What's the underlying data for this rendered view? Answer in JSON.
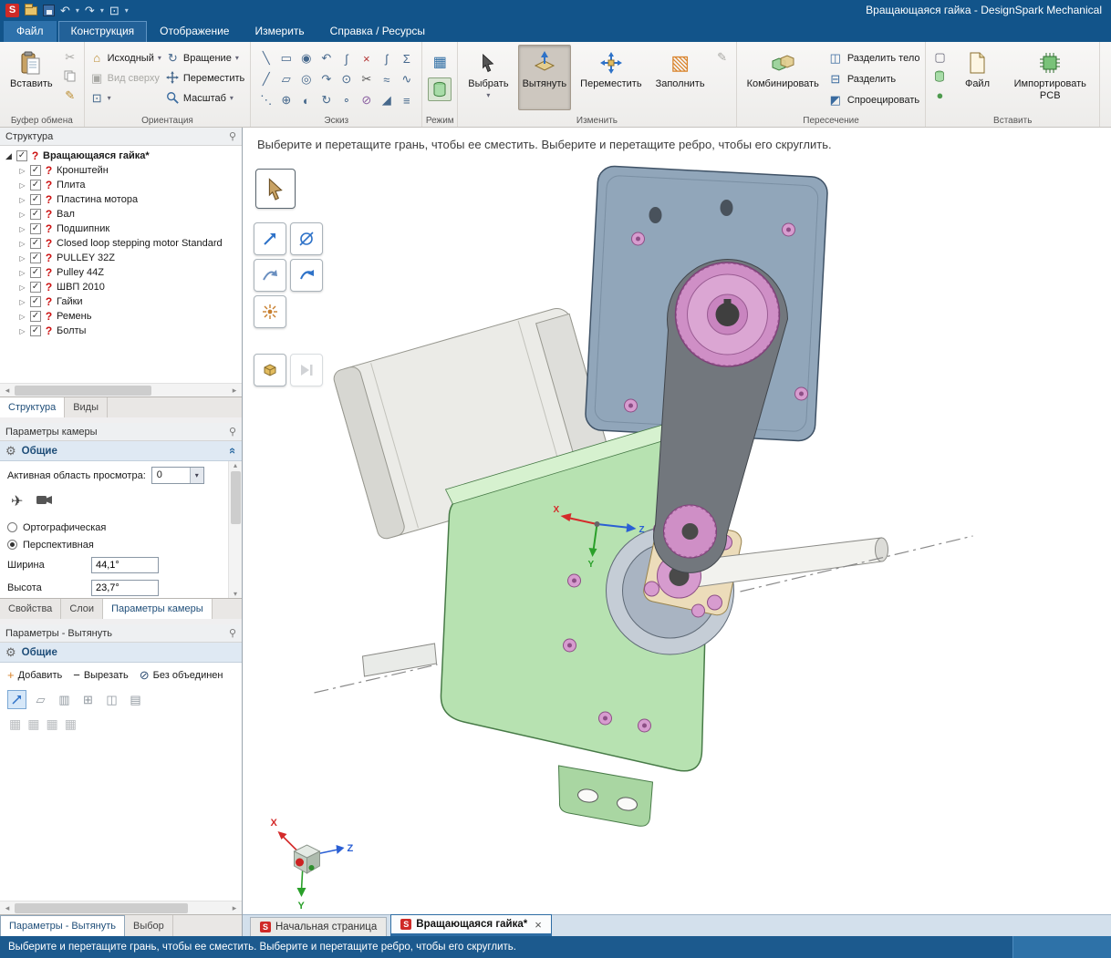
{
  "titlebar": {
    "title": "Вращающаяся гайка - DesignSpark Mechanical"
  },
  "menu": {
    "file": "Файл",
    "construct": "Конструкция",
    "display": "Отображение",
    "measure": "Измерить",
    "help": "Справка / Ресурсы"
  },
  "ribbon": {
    "clipboard": {
      "label": "Буфер обмена",
      "paste": "Вставить"
    },
    "orientation": {
      "label": "Ориентация",
      "home": "Исходный",
      "spin": "Вращение",
      "top": "Вид сверху",
      "pan": "Переместить",
      "zoom": "Масштаб"
    },
    "sketch": {
      "label": "Эскиз",
      "icons": [
        "╲",
        "▭",
        "◉",
        "↶",
        "∫",
        "×",
        "ʃ",
        "Σ",
        "╱",
        "▱",
        "◎",
        "↷",
        "⊙",
        "✂",
        "≈",
        "∿",
        "⋱",
        "⊕",
        "◐",
        "↻",
        "∘",
        "⊘",
        "◢",
        "≡"
      ]
    },
    "mode": {
      "label": "Режим"
    },
    "edit": {
      "label": "Изменить",
      "select": "Выбрать",
      "pull": "Вытянуть",
      "move": "Переместить",
      "fill": "Заполнить"
    },
    "intersect": {
      "label": "Пересечение",
      "combine": "Комбинировать",
      "split_body": "Разделить тело",
      "split": "Разделить",
      "project": "Спроецировать"
    },
    "insert": {
      "label": "Вставить",
      "file": "Файл",
      "pcb": "Импортировать PCB"
    }
  },
  "structure": {
    "header": "Структура",
    "root": "Вращающаяся гайка*",
    "items": [
      "Кронштейн",
      "Плита",
      "Пластина мотора",
      "Вал",
      "Подшипник",
      "Closed loop stepping motor Standard",
      "PULLEY 32Z",
      "Pulley 44Z",
      "ШВП 2010",
      "Гайки",
      "Ремень",
      "Болты"
    ],
    "tab_structure": "Структура",
    "tab_views": "Виды"
  },
  "camera": {
    "header": "Параметры камеры",
    "section": "Общие",
    "active_area_label": "Активная область просмотра:",
    "active_area_value": "0",
    "ortho": "Ортографическая",
    "persp": "Перспективная",
    "width_label": "Ширина",
    "width_value": "44,1°",
    "height_label": "Высота",
    "height_value": "23,7°",
    "tab_props": "Свойства",
    "tab_layers": "Слои",
    "tab_camera": "Параметры камеры"
  },
  "pull_panel": {
    "header": "Параметры - Вытянуть",
    "section": "Общие",
    "add": "Добавить",
    "cut": "Вырезать",
    "no_merge": "Без объединен",
    "icons_row1": [
      "▱",
      "▥",
      "⊞",
      "◫",
      "▤"
    ],
    "icons_row2": [
      "▦",
      "▦",
      "▦",
      "▦"
    ],
    "tab_pull": "Параметры - Вытянуть",
    "tab_select": "Выбор"
  },
  "viewport": {
    "hint": "Выберите и перетащите грань, чтобы ее сместить. Выберите и перетащите ребро, чтобы его скруглить."
  },
  "doc_tabs": {
    "start": "Начальная страница",
    "current": "Вращающаяся гайка*",
    "close": "×"
  },
  "statusbar": {
    "text": "Выберите и перетащите грань, чтобы ее сместить. Выберите и перетащите ребро, чтобы его скруглить."
  },
  "triad": {
    "x": "X",
    "y": "Y",
    "z": "Z"
  },
  "icons": {
    "caret_down": "▾",
    "logo_letter": "S",
    "undo": "↶",
    "redo": "↷",
    "monitor": "⊡",
    "scissors": "✂",
    "brush": "✎",
    "home": "⌂",
    "spin": "↻",
    "top_view": "▣",
    "mode_sketch": "▦",
    "fill": "▧",
    "split_body": "◫",
    "split": "⊟",
    "project": "◩",
    "insert_rect": "▢",
    "insert_sphere": "●",
    "check": "✓",
    "question": "?",
    "expander": "▷",
    "expander_open": "◢",
    "pin": "⚲",
    "collapse": "«",
    "gear": "⚙",
    "plane": "✈",
    "plus": "+",
    "minus": "−",
    "no_merge": "⊘",
    "left": "◂",
    "right": "▸",
    "up": "▴",
    "down": "▾",
    "edit_small": "✎"
  }
}
